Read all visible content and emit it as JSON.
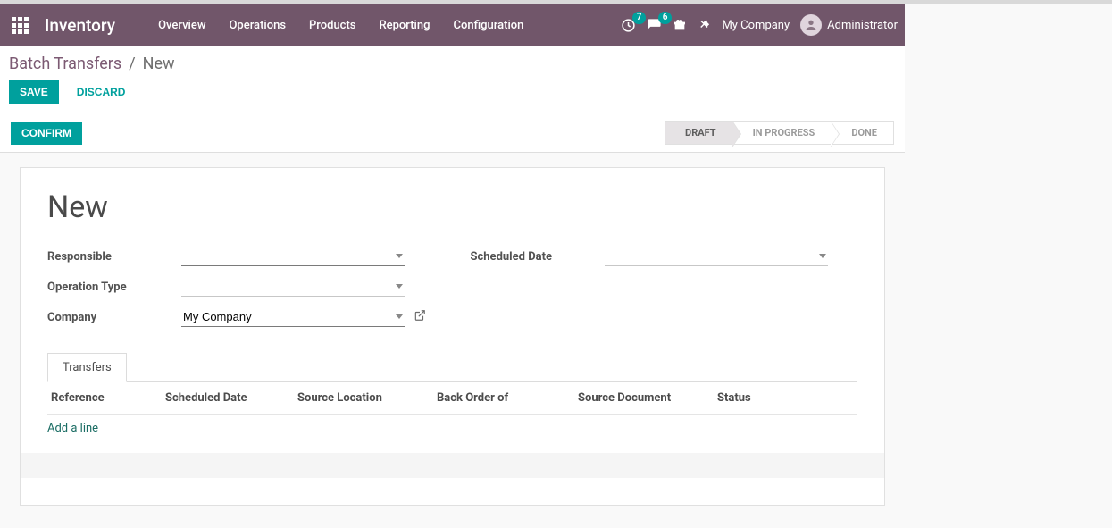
{
  "navbar": {
    "app_name": "Inventory",
    "menu": [
      "Overview",
      "Operations",
      "Products",
      "Reporting",
      "Configuration"
    ],
    "activities_badge": "7",
    "messages_badge": "6",
    "company": "My Company",
    "user": "Administrator"
  },
  "breadcrumb": {
    "parent": "Batch Transfers",
    "sep": "/",
    "current": "New"
  },
  "buttons": {
    "save": "SAVE",
    "discard": "DISCARD",
    "confirm": "CONFIRM"
  },
  "status_steps": {
    "draft": "DRAFT",
    "inprogress": "IN PROGRESS",
    "done": "DONE",
    "active": "draft"
  },
  "form": {
    "title": "New",
    "labels": {
      "responsible": "Responsible",
      "operation_type": "Operation Type",
      "company": "Company",
      "scheduled_date": "Scheduled Date"
    },
    "values": {
      "responsible": "",
      "operation_type": "",
      "company": "My Company",
      "scheduled_date": ""
    }
  },
  "tabs": {
    "transfers": "Transfers"
  },
  "list": {
    "headers": {
      "reference": "Reference",
      "scheduled_date": "Scheduled Date",
      "source_location": "Source Location",
      "back_order_of": "Back Order of",
      "source_document": "Source Document",
      "status": "Status"
    },
    "add_line": "Add a line"
  }
}
